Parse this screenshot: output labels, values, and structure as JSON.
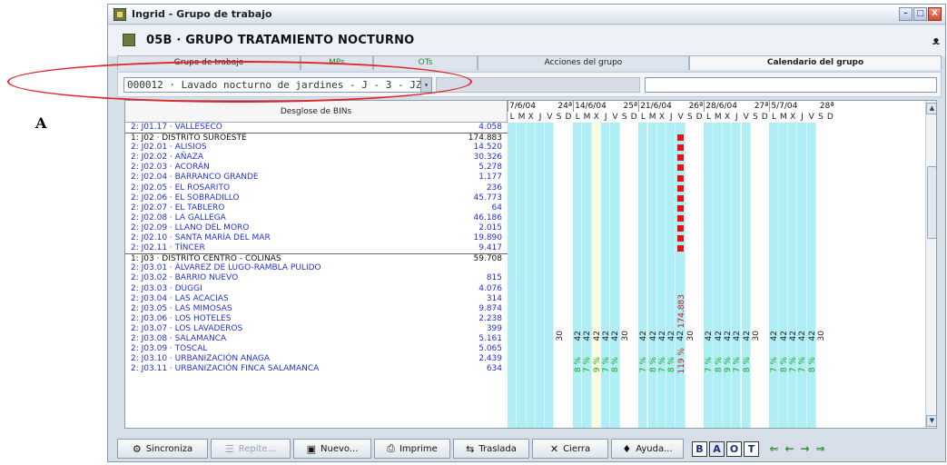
{
  "annotation": {
    "letter": "A"
  },
  "window": {
    "title": "Ingrid - Grupo de trabajo",
    "buttons": [
      "–",
      "□",
      "X"
    ]
  },
  "header": {
    "group_title": "05B · GRUPO TRATAMIENTO NOCTURNO",
    "search_glyph": "ᴥ"
  },
  "tabs": [
    {
      "label": "Grupo de trabajo",
      "width": 202,
      "style": "normal"
    },
    {
      "label": "MPs",
      "width": 80,
      "style": "green"
    },
    {
      "label": "OTs",
      "width": 115,
      "style": "green"
    },
    {
      "label": "Acciones del grupo",
      "width": 233,
      "style": "normal"
    },
    {
      "label": "Calendario del grupo",
      "width": 278,
      "style": "active"
    }
  ],
  "toolbar": {
    "combo_value": "000012 · Lavado nocturno de jardines  -  J  -  3  -  JZ1",
    "combo_arrow": "▾"
  },
  "grid": {
    "bins_header": "Desglose de BINs",
    "rows": [
      {
        "label": "2: J01.17 · VALLESECO",
        "value": "4.058",
        "level": 2
      },
      {
        "label": "1: J02 · DISTRITO SUROESTE",
        "value": "174.883",
        "level": 1
      },
      {
        "label": "2: J02.01 · ALISIOS",
        "value": "14.520",
        "level": 2
      },
      {
        "label": "2: J02.02 · AÑAZA",
        "value": "30.326",
        "level": 2
      },
      {
        "label": "2: J02.03 · ACORÁN",
        "value": "5.278",
        "level": 2
      },
      {
        "label": "2: J02.04 · BARRANCO GRANDE",
        "value": "1.177",
        "level": 2
      },
      {
        "label": "2: J02.05 · EL ROSARITO",
        "value": "236",
        "level": 2
      },
      {
        "label": "2: J02.06 · EL SOBRADILLO",
        "value": "45.773",
        "level": 2
      },
      {
        "label": "2: J02.07 · EL TABLERO",
        "value": "64",
        "level": 2
      },
      {
        "label": "2: J02.08 · LA GALLEGA",
        "value": "46.186",
        "level": 2
      },
      {
        "label": "2: J02.09 · LLANO DEL MORO",
        "value": "2.015",
        "level": 2
      },
      {
        "label": "2: J02.10 · SANTA MARÍA DEL MAR",
        "value": "19.890",
        "level": 2
      },
      {
        "label": "2: J02.11 · TÍNCER",
        "value": "9.417",
        "level": 2
      },
      {
        "label": "1: J03 · DISTRITO CENTRO - COLINAS",
        "value": "59.708",
        "level": 1
      },
      {
        "label": "2: J03.01 · ÁLVAREZ DE LUGO-RAMBLA PULIDO",
        "value": "",
        "level": 2
      },
      {
        "label": "2: J03.02 · BARRIO NUEVO",
        "value": "815",
        "level": 2
      },
      {
        "label": "2: J03.03 · DUGGI",
        "value": "4.076",
        "level": 2
      },
      {
        "label": "2: J03.04 · LAS ACACIAS",
        "value": "314",
        "level": 2
      },
      {
        "label": "2: J03.05 · LAS MIMOSAS",
        "value": "9.874",
        "level": 2
      },
      {
        "label": "2: J03.06 · LOS HOTELES",
        "value": "2.238",
        "level": 2
      },
      {
        "label": "2: J03.07 · LOS LAVADEROS",
        "value": "399",
        "level": 2
      },
      {
        "label": "2: J03.08 · SALAMANCA",
        "value": "5.161",
        "level": 2
      },
      {
        "label": "2: J03.09 · TOSCAL",
        "value": "5.065",
        "level": 2
      },
      {
        "label": "2: J03.10 · URBANIZACIÓN ANAGA",
        "value": "2.439",
        "level": 2
      },
      {
        "label": "2: J03.11 · URBANIZACIÓN FINCA SALAMANCA",
        "value": "634",
        "level": 2
      }
    ]
  },
  "calendar": {
    "weeks": [
      {
        "date": "7/6/04",
        "num": "24ª"
      },
      {
        "date": "14/6/04",
        "num": "25ª"
      },
      {
        "date": "21/6/04",
        "num": "26ª"
      },
      {
        "date": "28/6/04",
        "num": "27ª"
      },
      {
        "date": "5/7/04",
        "num": "28ª"
      }
    ],
    "day_letters": [
      "L",
      "M",
      "X",
      "J",
      "V",
      "S",
      "D"
    ],
    "red_marker_rows": [
      1,
      2,
      3,
      4,
      5,
      6,
      7,
      8,
      9,
      10,
      11,
      12
    ],
    "texts_174": "174.883",
    "label_42": "42",
    "label_30": "30",
    "label_119": "119 %",
    "label_8pct": "8 %",
    "label_7pct": "7 %",
    "label_9pct": "9 %"
  },
  "scrollbar": {
    "up": "▲",
    "down": "▼"
  },
  "bottom": {
    "buttons": [
      {
        "label": "Sincroniza",
        "icon": "⚙",
        "width": 100,
        "disabled": false
      },
      {
        "label": "Repite...",
        "icon": "☰",
        "width": 88,
        "disabled": true
      },
      {
        "label": "Nuevo...",
        "icon": "▣",
        "width": 86,
        "disabled": false
      },
      {
        "label": "Imprime",
        "icon": "⎙",
        "width": 84,
        "disabled": false
      },
      {
        "label": "Traslada",
        "icon": "⇆",
        "width": 84,
        "disabled": false
      },
      {
        "label": "Cierra",
        "icon": "✕",
        "width": 84,
        "disabled": false
      },
      {
        "label": "Ayuda...",
        "icon": "♦",
        "width": 80,
        "disabled": false
      }
    ],
    "nav_letters": [
      "B",
      "A",
      "O",
      "T"
    ],
    "arrows": [
      "⇐",
      "←",
      "→",
      "⇒"
    ]
  }
}
